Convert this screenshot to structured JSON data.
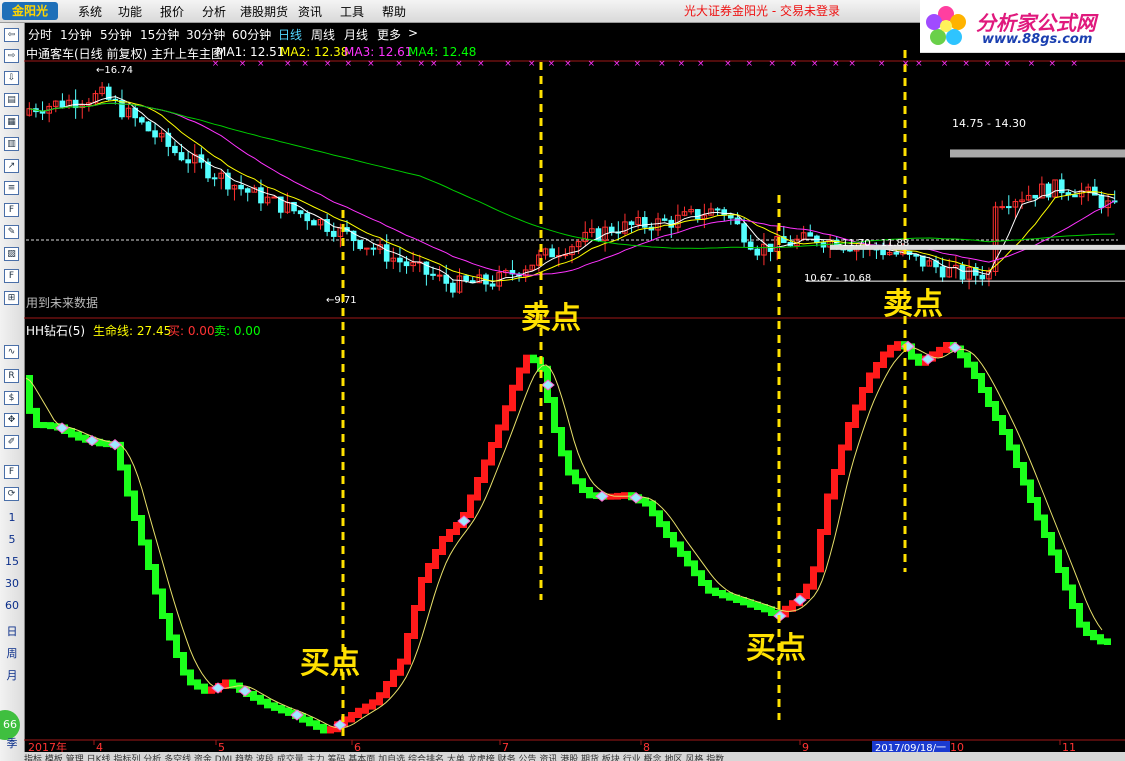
{
  "app": {
    "logo_text": "金阳光",
    "menu": [
      "系统",
      "功能",
      "报价",
      "分析",
      "港股期货",
      "资讯",
      "工具",
      "帮助"
    ],
    "center_title": "光大证券金阳光 - 交易未登录",
    "brand_name": "分析家公式网",
    "brand_url": "www.88gs.com"
  },
  "periods": [
    "分时",
    "1分钟",
    "5分钟",
    "15分钟",
    "30分钟",
    "60分钟",
    "日线",
    "周线",
    "月线",
    "更多",
    ">"
  ],
  "toolbar": {
    "numbers": [
      "1",
      "5",
      "15",
      "30",
      "60"
    ],
    "labels": [
      "日",
      "周",
      "月"
    ],
    "badge": "66",
    "season": "季"
  },
  "main_chart": {
    "title": "中通客车(日线 前复权) 主升上车主图",
    "ma": [
      {
        "label": "MA1: 12.51",
        "color": "#ffffff"
      },
      {
        "label": "MA2: 12.38",
        "color": "#ffff00"
      },
      {
        "label": "MA3: 12.61",
        "color": "#ff33ff"
      },
      {
        "label": "MA4: 12.48",
        "color": "#00ff00"
      }
    ],
    "note": "用到未来数据",
    "annotations": {
      "high": "16.74",
      "low": "9.71",
      "range1": "14.75 - 14.30",
      "range2": "11.70 - 11.88",
      "range3": "10.67 - 10.68"
    }
  },
  "indicator": {
    "name": "HH钻石(5)",
    "lifeline": "生命线: 27.45",
    "buy": "买: 0.00",
    "sell": "卖: 0.00"
  },
  "signals": {
    "sell_label": "卖点",
    "buy_label": "买点"
  },
  "xaxis": {
    "year_label": "2017年",
    "months": [
      "4",
      "5",
      "6",
      "7",
      "8",
      "9",
      "10",
      "11"
    ],
    "cursor_date": "2017/09/18/一"
  },
  "bottom_tabs": "指标 模板 管理 日K线 指标列 分析 多空线 资金 DMI 趋势 波段 成交量 主力 筹码 基本面 加自选 综合排名 大单 龙虎榜 财务 公告 资讯 港股 期货 板块 行业 概念 地区 风格 指数",
  "chart_data": {
    "type": "candlestick",
    "x": [
      "2017-03-27",
      "2017-09-18",
      "2017-11-30"
    ],
    "ylim": [
      9.5,
      17.2
    ],
    "price_points": [
      {
        "label": "high",
        "value": 16.74
      },
      {
        "label": "low",
        "value": 9.71
      }
    ],
    "horizontal_levels": [
      14.75,
      14.3,
      11.7,
      11.88,
      10.67,
      10.68
    ],
    "indicator_series": {
      "name": "HH钻石(5)",
      "lifeline": 27.45,
      "buy": 0.0,
      "sell": 0.0
    },
    "signals": [
      {
        "type": "sell",
        "label": "卖点"
      },
      {
        "type": "buy",
        "label": "买点"
      },
      {
        "type": "buy",
        "label": "买点"
      },
      {
        "type": "sell",
        "label": "卖点"
      }
    ]
  }
}
